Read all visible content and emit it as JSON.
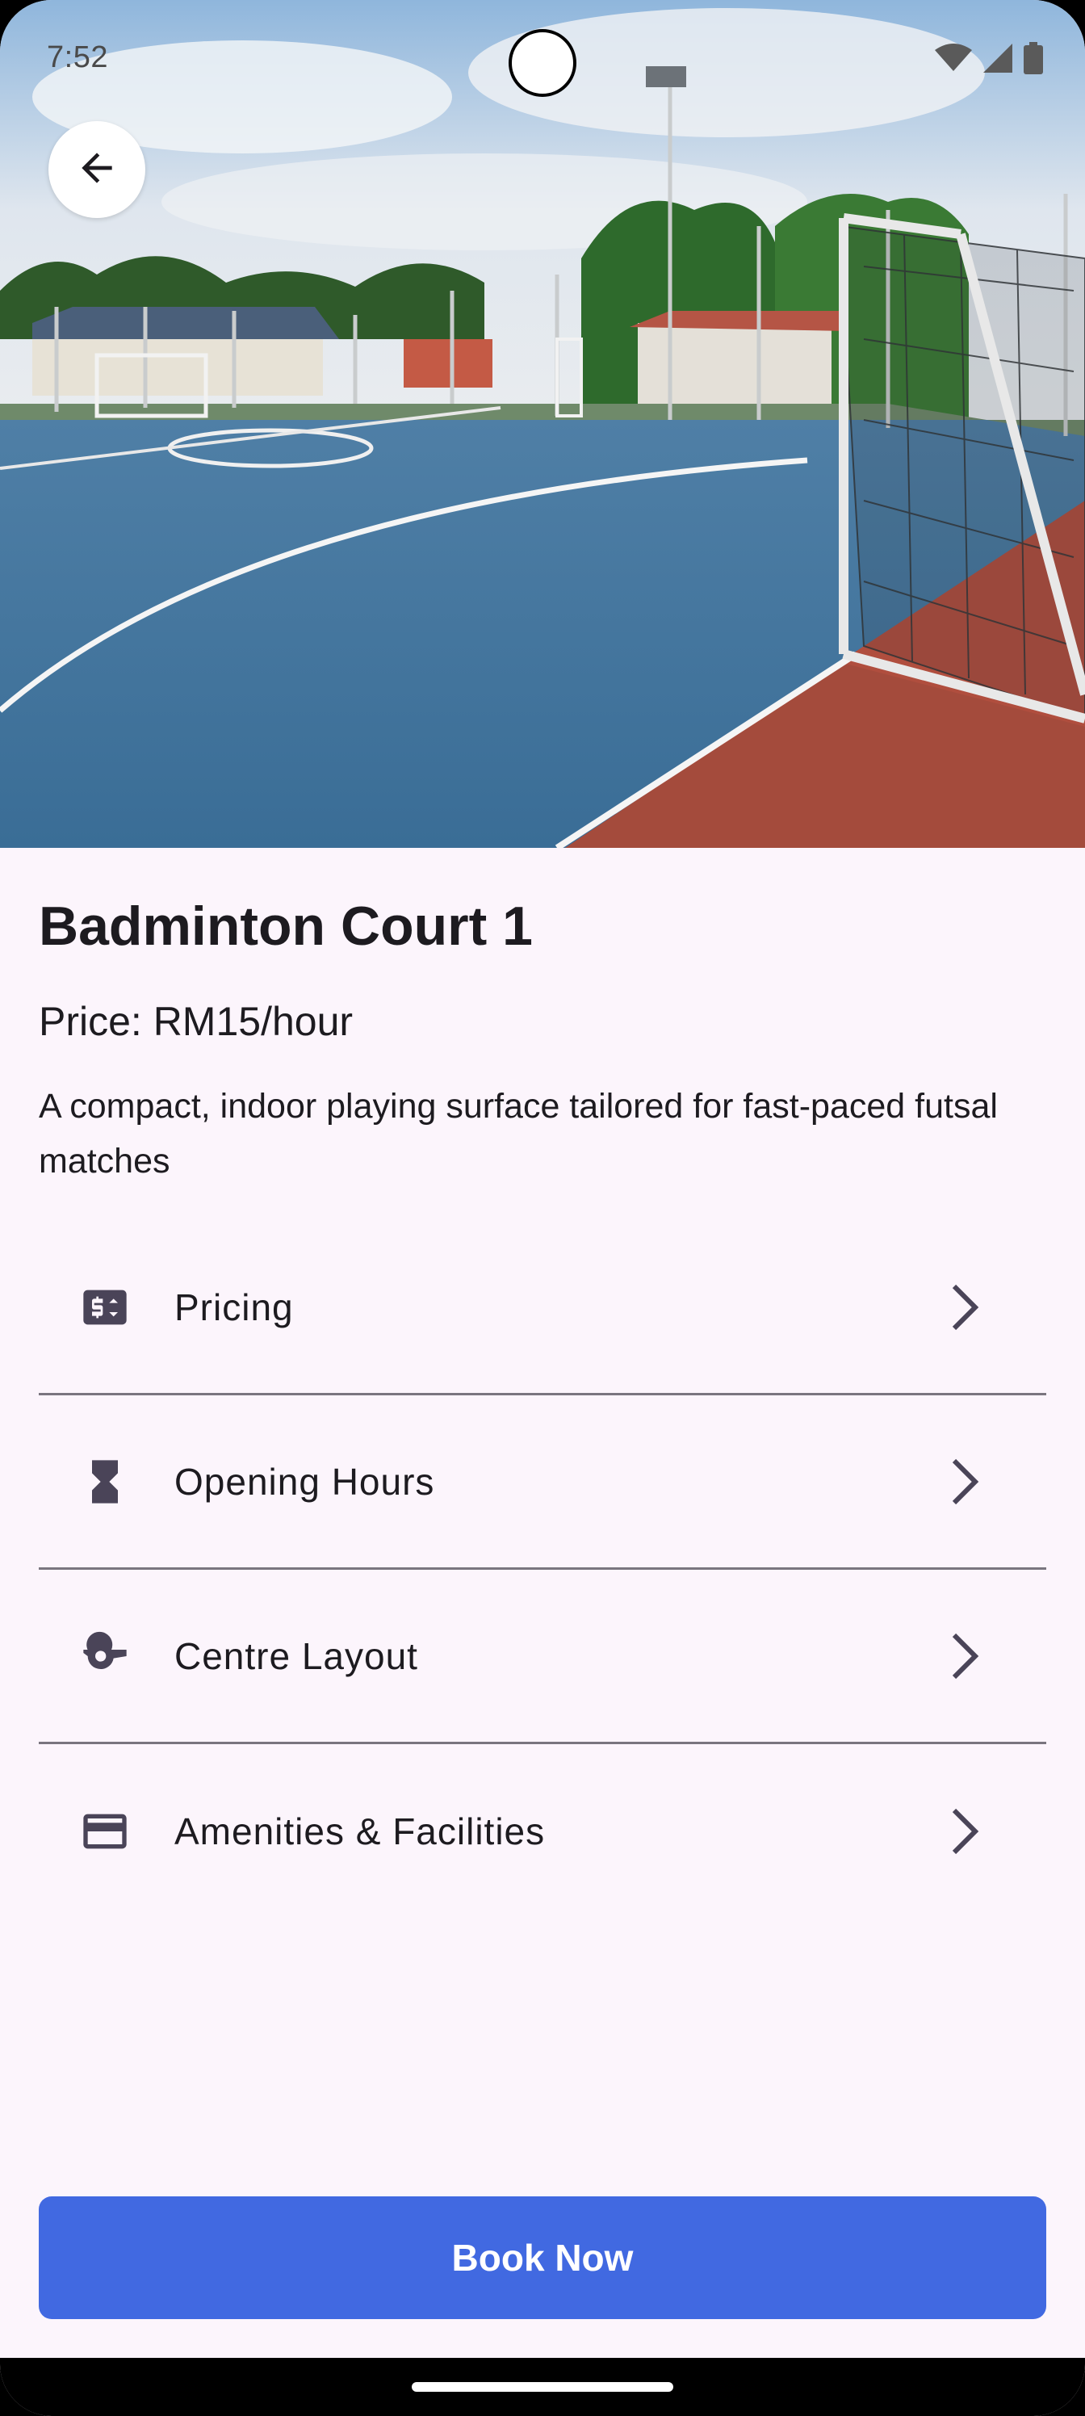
{
  "status_bar": {
    "time": "7:52",
    "icons": [
      "wifi-icon",
      "signal-icon",
      "battery-icon"
    ]
  },
  "hero": {
    "back_icon": "arrow-left-icon"
  },
  "court": {
    "title": "Badminton Court 1",
    "price": "Price: RM15/hour",
    "description": "A compact, indoor playing surface tailored for fast-paced futsal matches"
  },
  "menu": {
    "items": [
      {
        "label": "Pricing",
        "icon": "price-tag-icon"
      },
      {
        "label": "Opening Hours",
        "icon": "hourglass-icon"
      },
      {
        "label": "Centre Layout",
        "icon": "whistle-icon"
      },
      {
        "label": "Amenities & Facilities",
        "icon": "card-icon"
      }
    ]
  },
  "actions": {
    "book_label": "Book Now"
  },
  "colors": {
    "accent": "#4169e1",
    "background": "#fcf5fc",
    "text": "#1d1b20",
    "divider": "#7a757f"
  }
}
